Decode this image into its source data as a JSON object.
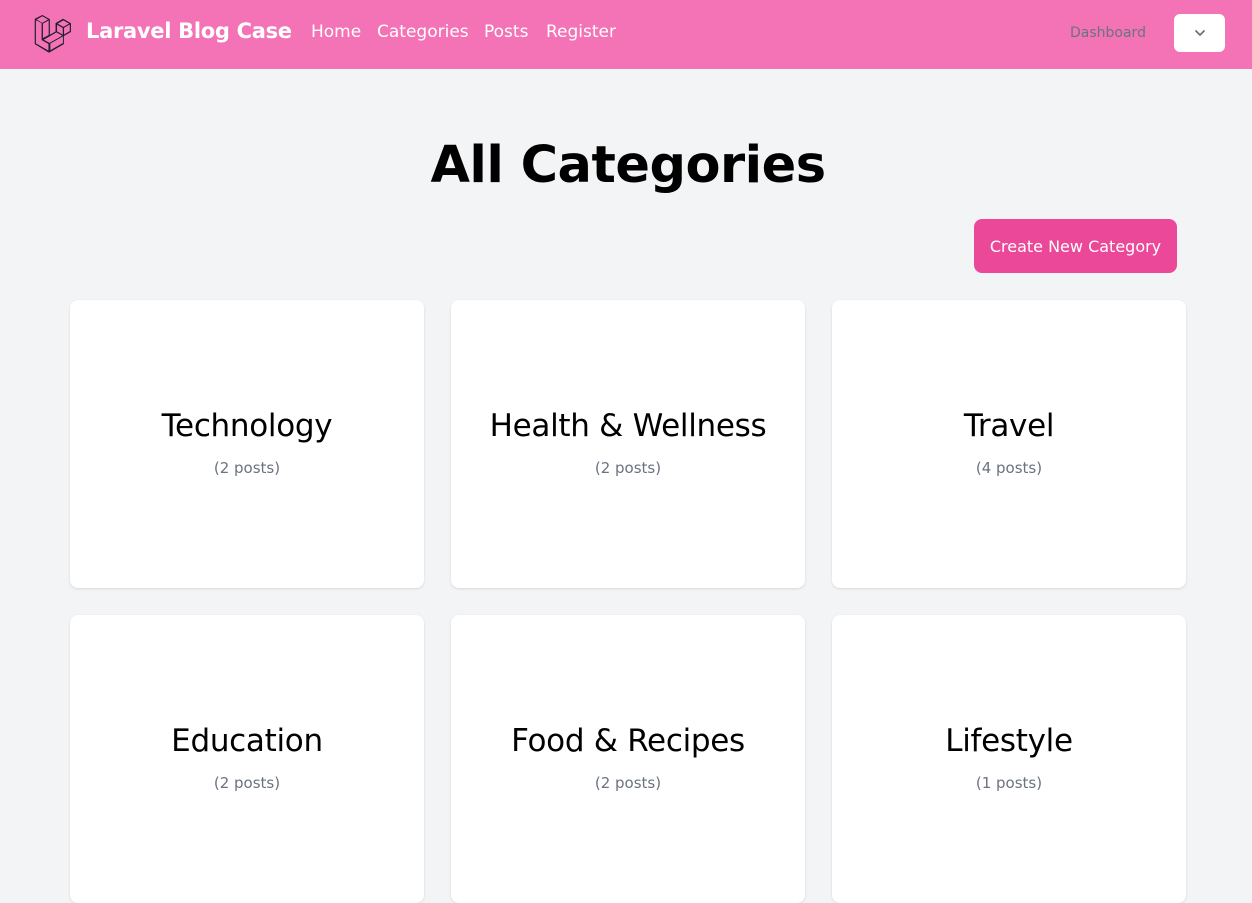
{
  "header": {
    "brand": "Laravel Blog Case",
    "nav": [
      {
        "label": "Home"
      },
      {
        "label": "Categories"
      },
      {
        "label": "Posts"
      },
      {
        "label": "Register"
      }
    ],
    "dashboard_label": "Dashboard",
    "dropdown_icon": "chevron-down-icon"
  },
  "main": {
    "title": "All Categories",
    "create_button_label": "Create New Category",
    "categories": [
      {
        "name": "Technology",
        "count": "(2 posts)"
      },
      {
        "name": "Health & Wellness",
        "count": "(2 posts)"
      },
      {
        "name": "Travel",
        "count": "(4 posts)"
      },
      {
        "name": "Education",
        "count": "(2 posts)"
      },
      {
        "name": "Food & Recipes",
        "count": "(2 posts)"
      },
      {
        "name": "Lifestyle",
        "count": "(1 posts)"
      }
    ]
  },
  "colors": {
    "navbar": "#f472b6",
    "accent_button": "#ec4899",
    "background": "#f3f4f6"
  }
}
